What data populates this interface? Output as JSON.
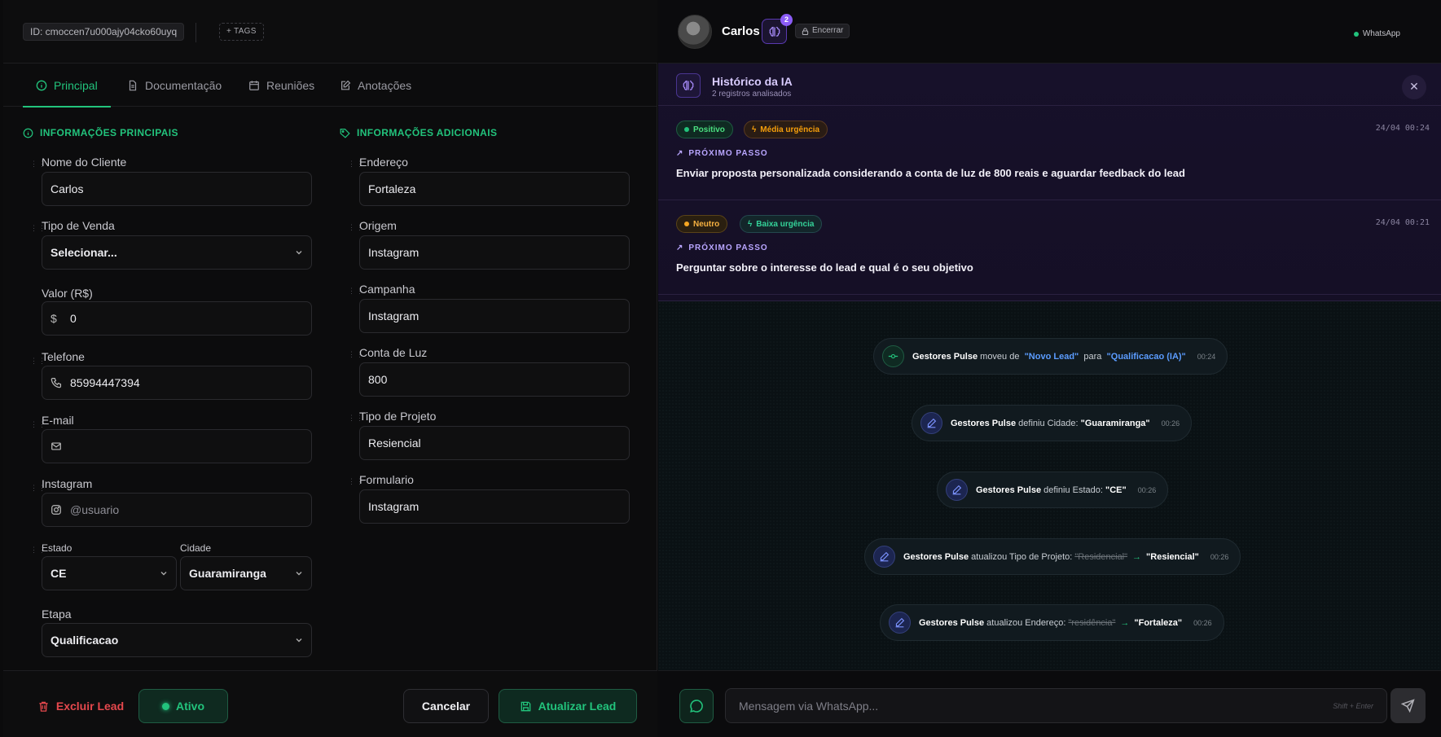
{
  "left": {
    "lead_id": "ID: cmoccen7u000ajy04cko60uyq",
    "tags_label": "+ TAGS",
    "tabs": [
      {
        "label": "Principal"
      },
      {
        "label": "Documentação"
      },
      {
        "label": "Reuniões"
      },
      {
        "label": "Anotações"
      }
    ],
    "section_main": "INFORMAÇÕES PRINCIPAIS",
    "section_extra": "INFORMAÇÕES ADICIONAIS",
    "fields_main": {
      "nome_label": "Nome do Cliente",
      "nome_value": "Carlos",
      "tipo_venda_label": "Tipo de Venda",
      "tipo_venda_value": "Selecionar...",
      "valor_label": "Valor (R$)",
      "valor_value": "0",
      "valor_prefix": "$",
      "telefone_label": "Telefone",
      "telefone_value": "85994447394",
      "email_label": "E-mail",
      "email_value": "",
      "instagram_label": "Instagram",
      "instagram_placeholder": "@usuario",
      "estado_label": "Estado",
      "estado_value": "CE",
      "cidade_label": "Cidade",
      "cidade_value": "Guaramiranga",
      "etapa_label": "Etapa",
      "etapa_value": "Qualificacao"
    },
    "fields_extra": {
      "endereco_label": "Endereço",
      "endereco_value": "Fortaleza",
      "origem_label": "Origem",
      "origem_value": "Instagram",
      "campanha_label": "Campanha",
      "campanha_value": "Instagram",
      "conta_label": "Conta de Luz",
      "conta_value": "800",
      "projeto_label": "Tipo de Projeto",
      "projeto_value": "Resiencial",
      "formulario_label": "Formulario",
      "formulario_value": "Instagram"
    },
    "footer": {
      "delete_label": "Excluir Lead",
      "status_label": "Ativo",
      "cancel_label": "Cancelar",
      "update_label": "Atualizar Lead"
    }
  },
  "right": {
    "contact_name": "Carlos",
    "ai_badge_count": "2",
    "encerrar_label": "Encerrar",
    "channel_label": "WhatsApp",
    "ai_history": {
      "title": "Histórico da IA",
      "subtitle": "2 registros analisados",
      "close_label": "✕",
      "entries": [
        {
          "sentiment": "Positivo",
          "urgency": "Média urgência",
          "time": "24/04 00:24",
          "next_label": "PRÓXIMO PASSO",
          "next_text": "Enviar proposta personalizada considerando a conta de luz de 800 reais e aguardar feedback do lead"
        },
        {
          "sentiment": "Neutro",
          "urgency": "Baixa urgência",
          "time": "24/04 00:21",
          "next_label": "PRÓXIMO PASSO",
          "next_text": "Perguntar sobre o interesse do lead e qual é o seu objetivo"
        }
      ]
    },
    "events": [
      {
        "actor": "Gestores Pulse",
        "action": "moveu de",
        "from": "\"Novo Lead\"",
        "mid": "para",
        "to": "\"Qualificacao (IA)\"",
        "time": "00:24"
      },
      {
        "actor": "Gestores Pulse",
        "action": "definiu Cidade:",
        "value": "\"Guaramiranga\"",
        "time": "00:26"
      },
      {
        "actor": "Gestores Pulse",
        "action": "definiu Estado:",
        "value": "\"CE\"",
        "time": "00:26"
      },
      {
        "actor": "Gestores Pulse",
        "action": "atualizou Tipo de Projeto:",
        "old": "\"Residencial\"",
        "arrow": "→",
        "value": "\"Resiencial\"",
        "time": "00:26"
      },
      {
        "actor": "Gestores Pulse",
        "action": "atualizou Endereço:",
        "old": "\"residência\"",
        "arrow": "→",
        "value": "\"Fortaleza\"",
        "time": "00:26"
      }
    ],
    "composer": {
      "placeholder": "Mensagem via WhatsApp...",
      "hint": "Shift + Enter"
    }
  },
  "colors": {
    "accent_green": "#22c37c",
    "accent_purple": "#8b5cf6",
    "danger": "#e5484d",
    "link_blue": "#5b9cff"
  }
}
